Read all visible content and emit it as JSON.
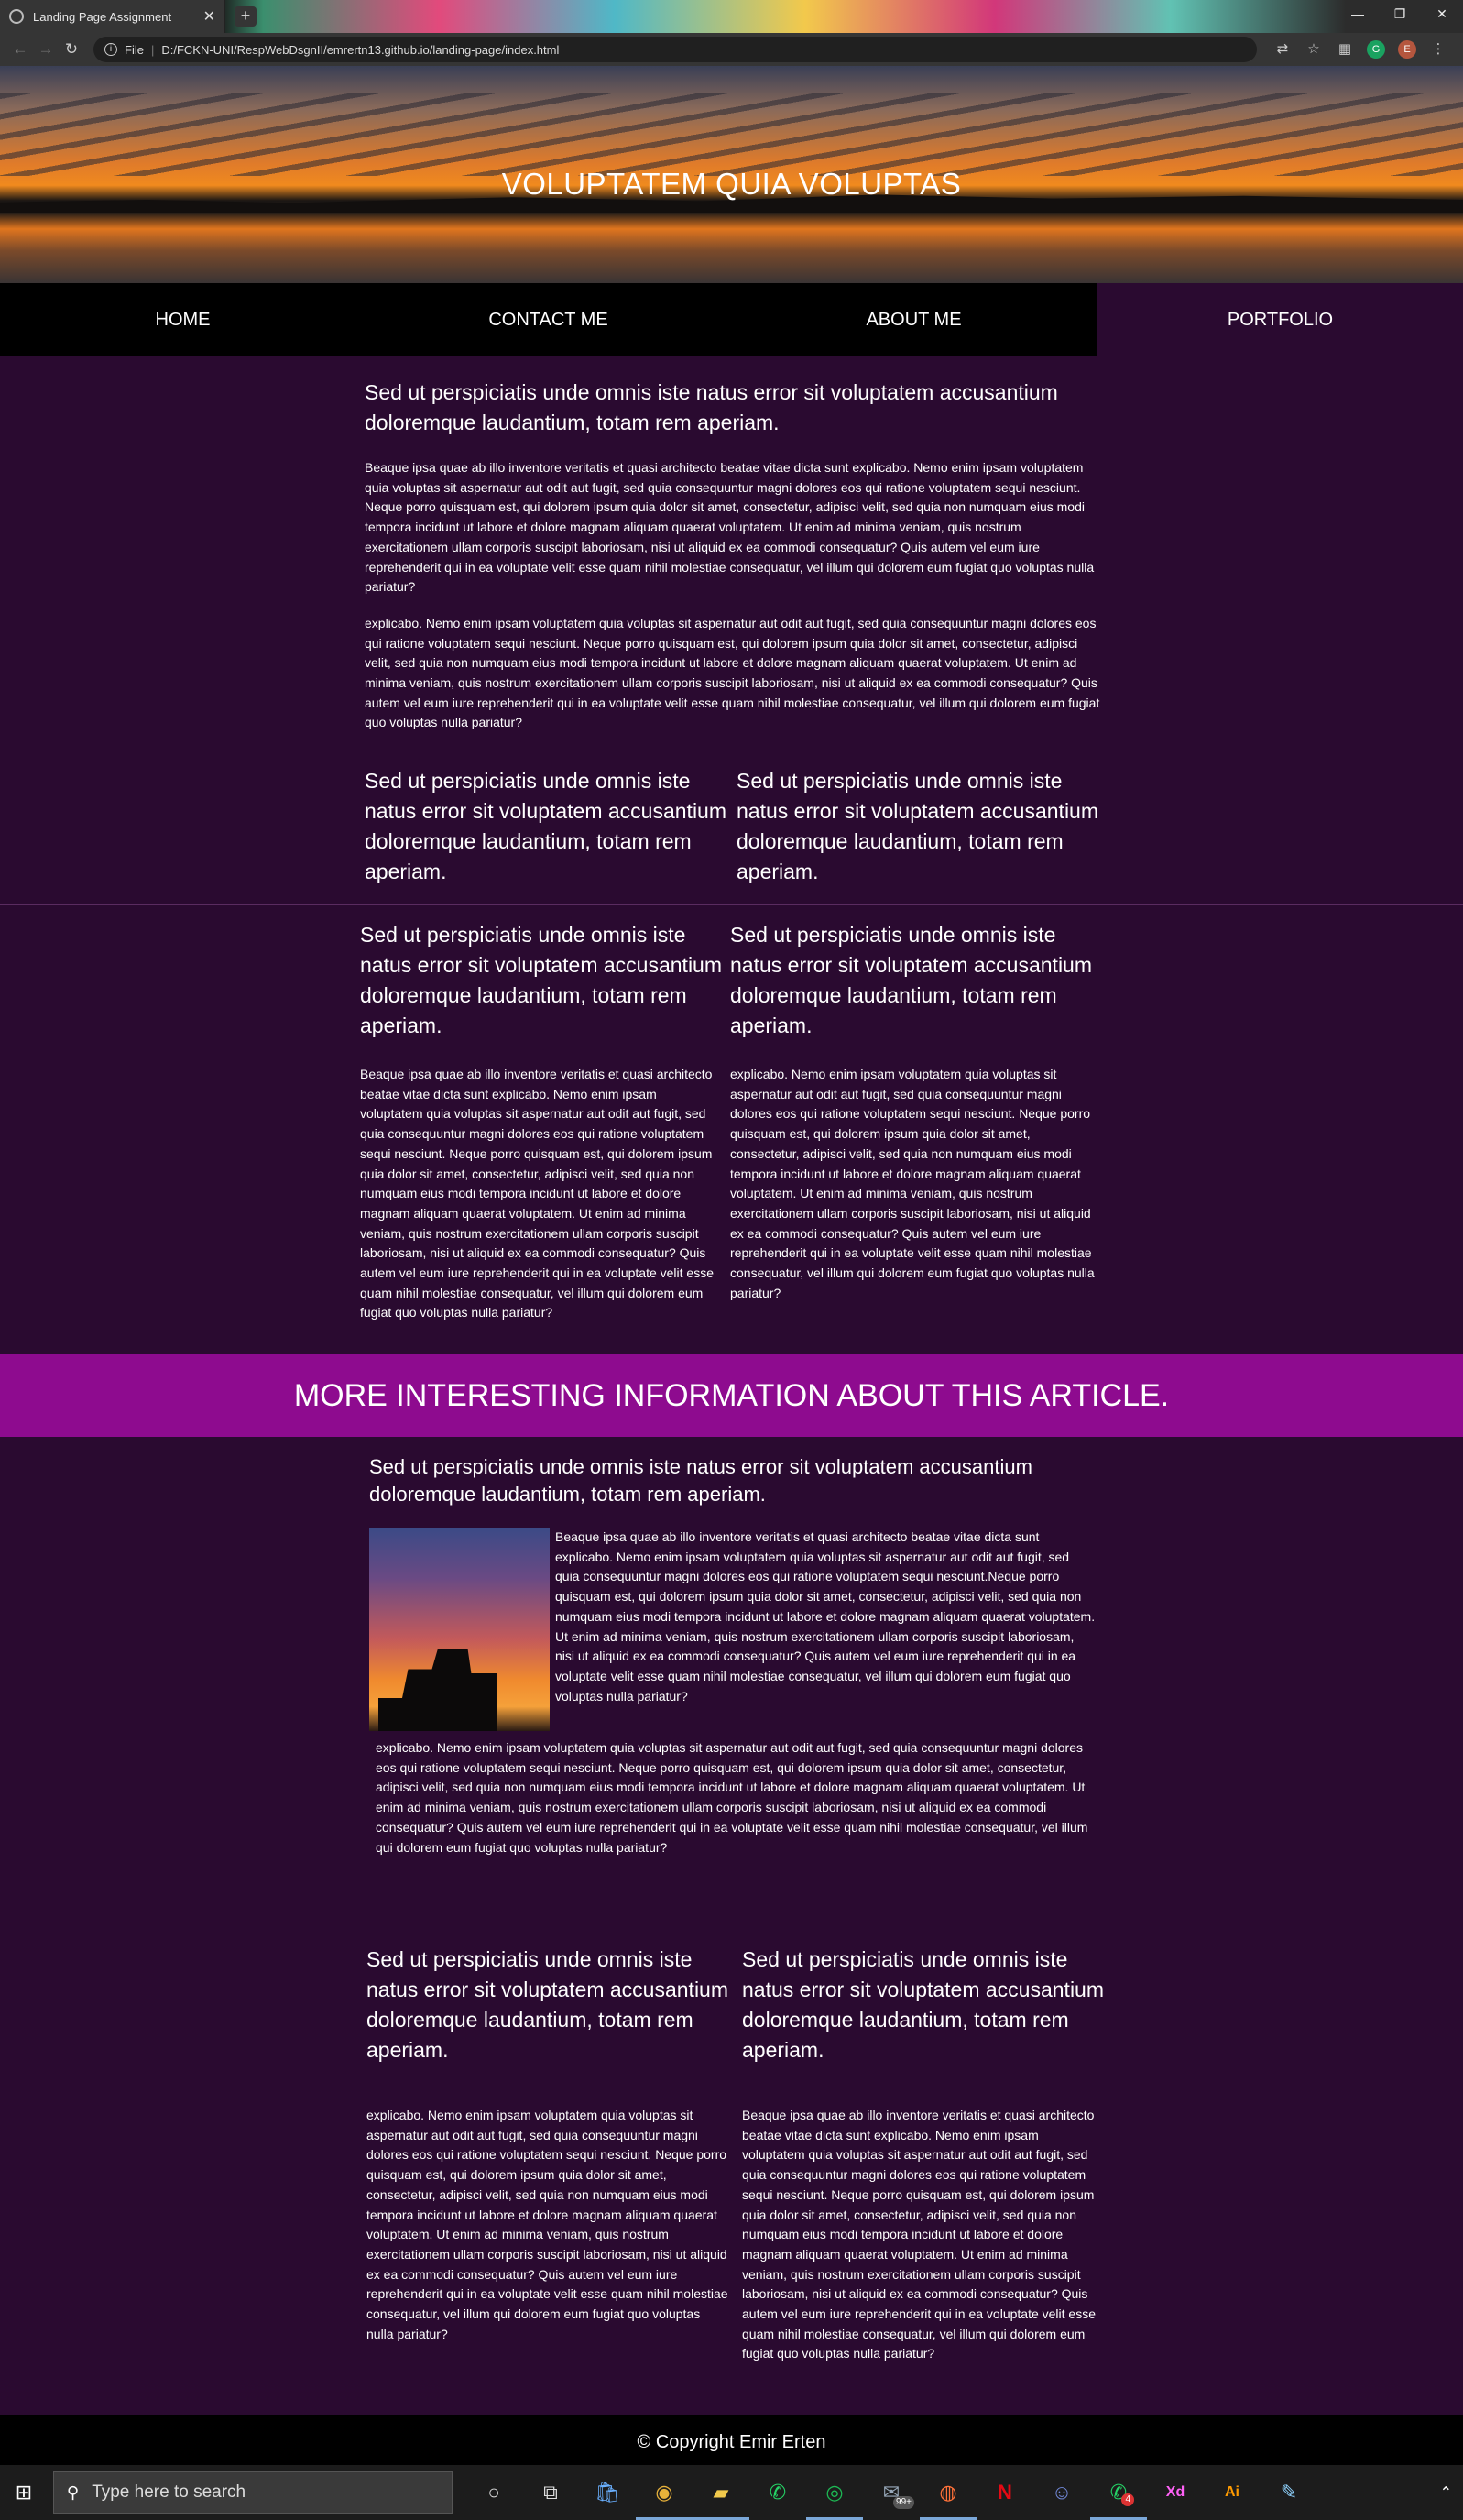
{
  "browser": {
    "tab_title": "Landing Page Assignment",
    "tab_close": "✕",
    "new_tab": "+",
    "window_controls": [
      "—",
      "❐",
      "✕"
    ],
    "scheme_label": "File",
    "url": "D:/FCKN-UNI/RespWebDsgnII/emrertn13.github.io/landing-page/index.html",
    "profile_initial": "E"
  },
  "hero": {
    "title": "VOLUPTATEM QUIA VOLUPTAS"
  },
  "nav": {
    "items": [
      "HOME",
      "CONTACT ME",
      "ABOUT ME",
      "PORTFOLIO"
    ],
    "active_index": 3
  },
  "section1": {
    "heading": "Sed ut perspiciatis unde omnis iste natus error sit voluptatem accusantium doloremque laudantium, totam rem aperiam.",
    "para1": "Beaque ipsa quae ab illo inventore veritatis et quasi architecto beatae vitae dicta sunt explicabo. Nemo enim ipsam voluptatem quia voluptas sit aspernatur aut odit aut fugit, sed quia consequuntur magni dolores eos qui ratione voluptatem sequi nesciunt. Neque porro quisquam est, qui dolorem ipsum quia dolor sit amet, consectetur, adipisci velit, sed quia non numquam eius modi tempora incidunt ut labore et dolore magnam aliquam quaerat voluptatem. Ut enim ad minima veniam, quis nostrum exercitationem ullam corporis suscipit laboriosam, nisi ut aliquid ex ea commodi consequatur? Quis autem vel eum iure reprehenderit qui in ea voluptate velit esse quam nihil molestiae consequatur, vel illum qui dolorem eum fugiat quo voluptas nulla pariatur?",
    "para2": "explicabo. Nemo enim ipsam voluptatem quia voluptas sit aspernatur aut odit aut fugit, sed quia consequuntur magni dolores eos qui ratione voluptatem sequi nesciunt. Neque porro quisquam est, qui dolorem ipsum quia dolor sit amet, consectetur, adipisci velit, sed quia non numquam eius modi tempora incidunt ut labore et dolore magnam aliquam quaerat voluptatem. Ut enim ad minima veniam, quis nostrum exercitationem ullam corporis suscipit laboriosam, nisi ut aliquid ex ea commodi consequatur? Quis autem vel eum iure reprehenderit qui in ea voluptate velit esse quam nihil molestiae consequatur, vel illum qui dolorem eum fugiat quo voluptas nulla pariatur?",
    "col_heading_left": "Sed ut perspiciatis unde omnis iste natus error sit voluptatem accusantium doloremque laudantium, totam rem aperiam.",
    "col_heading_right": "Sed ut perspiciatis unde omnis iste natus error sit voluptatem accusantium doloremque laudantium, totam rem aperiam."
  },
  "section2": {
    "heading_left": "Sed ut perspiciatis unde omnis iste natus error sit voluptatem accusantium doloremque laudantium, totam rem aperiam.",
    "heading_right": "Sed ut perspiciatis unde omnis iste natus error sit voluptatem accusantium doloremque laudantium, totam rem aperiam.",
    "text_left": "Beaque ipsa quae ab illo inventore veritatis et quasi architecto beatae vitae dicta sunt explicabo. Nemo enim ipsam voluptatem quia voluptas sit aspernatur aut odit aut fugit, sed quia consequuntur magni dolores eos qui ratione voluptatem sequi nesciunt. Neque porro quisquam est, qui dolorem ipsum quia dolor sit amet, consectetur, adipisci velit, sed quia non numquam eius modi tempora incidunt ut labore et dolore magnam aliquam quaerat voluptatem. Ut enim ad minima veniam, quis nostrum exercitationem ullam corporis suscipit laboriosam, nisi ut aliquid ex ea commodi consequatur? Quis autem vel eum iure reprehenderit qui in ea voluptate velit esse quam nihil molestiae consequatur, vel illum qui dolorem eum fugiat quo voluptas nulla pariatur?",
    "text_right": "explicabo. Nemo enim ipsam voluptatem quia voluptas sit aspernatur aut odit aut fugit, sed quia consequuntur magni dolores eos qui ratione voluptatem sequi nesciunt. Neque porro quisquam est, qui dolorem ipsum quia dolor sit amet, consectetur, adipisci velit, sed quia non numquam eius modi tempora incidunt ut labore et dolore magnam aliquam quaerat voluptatem. Ut enim ad minima veniam, quis nostrum exercitationem ullam corporis suscipit laboriosam, nisi ut aliquid ex ea commodi consequatur? Quis autem vel eum iure reprehenderit qui in ea voluptate velit esse quam nihil molestiae consequatur, vel illum qui dolorem eum fugiat quo voluptas nulla pariatur?"
  },
  "banner": {
    "text": "MORE INTERESTING INFORMATION ABOUT THIS ARTICLE."
  },
  "section3": {
    "heading": "Sed ut perspiciatis unde omnis iste natus error sit voluptatem accusantium doloremque laudantium, totam rem aperiam.",
    "beside_image": "Beaque ipsa quae ab illo inventore veritatis et quasi architecto beatae vitae dicta sunt explicabo. Nemo enim ipsam voluptatem quia voluptas sit aspernatur aut odit aut fugit, sed quia consequuntur magni dolores eos qui ratione voluptatem sequi nesciunt.Neque porro quisquam est, qui dolorem ipsum quia dolor sit amet, consectetur, adipisci velit, sed quia non numquam eius modi tempora incidunt ut labore et dolore magnam aliquam quaerat voluptatem. Ut enim ad minima veniam, quis nostrum exercitationem ullam corporis suscipit laboriosam, nisi ut aliquid ex ea commodi consequatur? Quis autem vel eum iure reprehenderit qui in ea voluptate velit esse quam nihil molestiae consequatur, vel illum qui dolorem eum fugiat quo voluptas nulla pariatur?",
    "below_image": "explicabo. Nemo enim ipsam voluptatem quia voluptas sit aspernatur aut odit aut fugit, sed quia consequuntur magni dolores eos qui ratione voluptatem sequi nesciunt. Neque porro quisquam est, qui dolorem ipsum quia dolor sit amet, consectetur, adipisci velit, sed quia non numquam eius modi tempora incidunt ut labore et dolore magnam aliquam quaerat voluptatem. Ut enim ad minima veniam, quis nostrum exercitationem ullam corporis suscipit laboriosam, nisi ut aliquid ex ea commodi consequatur? Quis autem vel eum iure reprehenderit qui in ea voluptate velit esse quam nihil molestiae consequatur, vel illum qui dolorem eum fugiat quo voluptas nulla pariatur?"
  },
  "section4": {
    "heading_left": "Sed ut perspiciatis unde omnis iste natus error sit voluptatem accusantium doloremque laudantium, totam rem aperiam.",
    "heading_right": "Sed ut perspiciatis unde omnis iste natus error sit voluptatem accusantium doloremque laudantium, totam rem aperiam.",
    "text_left": "explicabo. Nemo enim ipsam voluptatem quia voluptas sit aspernatur aut odit aut fugit, sed quia consequuntur magni dolores eos qui ratione voluptatem sequi nesciunt. Neque porro quisquam est, qui dolorem ipsum quia dolor sit amet, consectetur, adipisci velit, sed quia non numquam eius modi tempora incidunt ut labore et dolore magnam aliquam quaerat voluptatem. Ut enim ad minima veniam, quis nostrum exercitationem ullam corporis suscipit laboriosam, nisi ut aliquid ex ea commodi consequatur? Quis autem vel eum iure reprehenderit qui in ea voluptate velit esse quam nihil molestiae consequatur, vel illum qui dolorem eum fugiat quo voluptas nulla pariatur?",
    "text_right": "Beaque ipsa quae ab illo inventore veritatis et quasi architecto beatae vitae dicta sunt explicabo. Nemo enim ipsam voluptatem quia voluptas sit aspernatur aut odit aut fugit, sed quia consequuntur magni dolores eos qui ratione voluptatem sequi nesciunt. Neque porro quisquam est, qui dolorem ipsum quia dolor sit amet, consectetur, adipisci velit, sed quia non numquam eius modi tempora incidunt ut labore et dolore magnam aliquam quaerat voluptatem. Ut enim ad minima veniam, quis nostrum exercitationem ullam corporis suscipit laboriosam, nisi ut aliquid ex ea commodi consequatur? Quis autem vel eum iure reprehenderit qui in ea voluptate velit esse quam nihil molestiae consequatur, vel illum qui dolorem eum fugiat quo voluptas nulla pariatur?"
  },
  "footer": {
    "text": "© Copyright Emir Erten"
  },
  "taskbar": {
    "search_placeholder": "Type here to search",
    "mail_badge": "99+",
    "whatsapp_badge": "4",
    "icons": [
      "cortana-icon",
      "task-view-icon",
      "store-icon",
      "chrome-icon",
      "file-explorer-icon",
      "whatsapp-icon",
      "spotify-icon",
      "mail-icon",
      "firefox-icon",
      "netflix-icon",
      "discord-icon",
      "whatsapp-beta-icon",
      "adobe-xd-icon",
      "illustrator-icon",
      "notepad-icon"
    ]
  }
}
